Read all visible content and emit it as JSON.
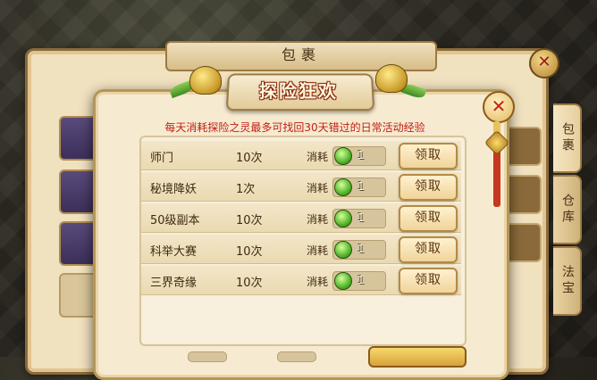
{
  "bag": {
    "title": "包裹",
    "tabs": [
      {
        "label": "包裹",
        "active": true
      },
      {
        "label": "仓库",
        "active": false
      },
      {
        "label": "法宝",
        "active": false
      }
    ]
  },
  "dialog": {
    "banner_title": "探险狂欢",
    "description": "每天消耗探险之灵最多可找回30天错过的日常活动经验",
    "close_label": "✕",
    "cost_label": "消耗",
    "claim_label": "领取",
    "rows": [
      {
        "name": "师门",
        "count": "10次",
        "cost": "1"
      },
      {
        "name": "秘境降妖",
        "count": "1次",
        "cost": "1"
      },
      {
        "name": "50级副本",
        "count": "10次",
        "cost": "1"
      },
      {
        "name": "科举大赛",
        "count": "10次",
        "cost": "1"
      },
      {
        "name": "三界奇缘",
        "count": "10次",
        "cost": "1"
      }
    ]
  },
  "colors": {
    "accent_red": "#c21e14",
    "panel_beige": "#f6ead0",
    "gold": "#d6a33a"
  }
}
